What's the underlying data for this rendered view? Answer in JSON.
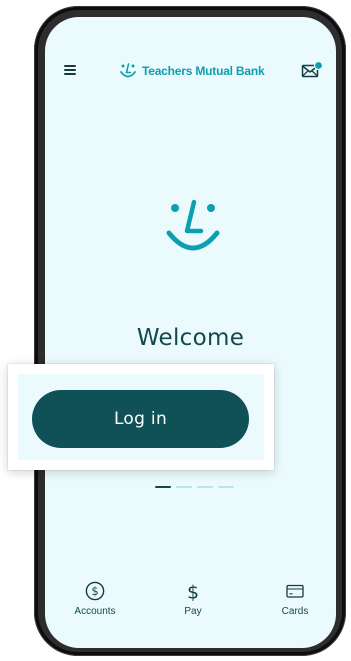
{
  "header": {
    "brand_name": "Teachers Mutual Bank",
    "menu_icon": "hamburger-menu-icon",
    "mail_icon": "mail-notification-icon",
    "mail_badge": true
  },
  "main": {
    "welcome_text": "Welcome",
    "login_label": "Log in",
    "carousel": {
      "total_pages": 4,
      "active_page": 1
    }
  },
  "bottom_nav": {
    "items": [
      {
        "label": "Accounts",
        "icon": "dollar-circle-icon"
      },
      {
        "label": "Pay",
        "icon": "dollar-sign-icon"
      },
      {
        "label": "Cards",
        "icon": "credit-card-icon"
      }
    ]
  },
  "colors": {
    "screen_background": "#ebfbfd",
    "brand_teal": "#0c9fb1",
    "primary_dark": "#0f5157",
    "text_dark": "#15484d",
    "carousel_inactive": "#b8e6ec"
  }
}
